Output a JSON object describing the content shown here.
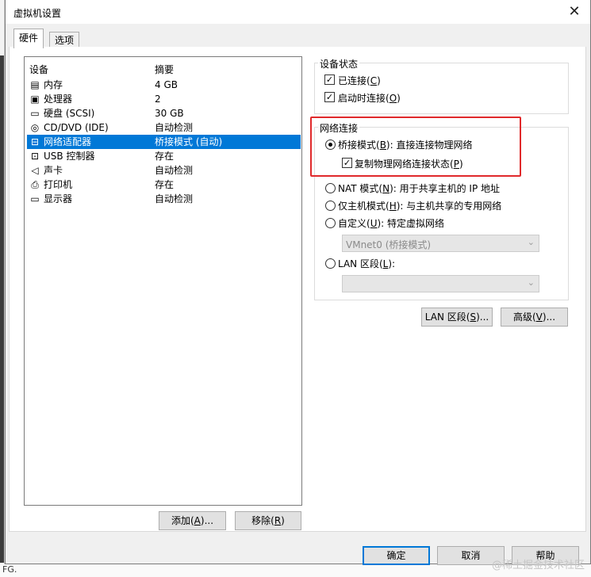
{
  "window": {
    "title": "虚拟机设置"
  },
  "tabs": [
    {
      "label": "硬件"
    },
    {
      "label": "选项"
    }
  ],
  "device_list": {
    "headers": {
      "device": "设备",
      "summary": "摘要"
    },
    "rows": [
      {
        "icon": "memory-icon",
        "name": "内存",
        "summary": "4 GB"
      },
      {
        "icon": "processor-icon",
        "name": "处理器",
        "summary": "2"
      },
      {
        "icon": "hard-disk-icon",
        "name": "硬盘 (SCSI)",
        "summary": "30 GB"
      },
      {
        "icon": "cd-dvd-icon",
        "name": "CD/DVD (IDE)",
        "summary": "自动检测"
      },
      {
        "icon": "network-adapter-icon",
        "name": "网络适配器",
        "summary": "桥接模式 (自动)",
        "selected": true
      },
      {
        "icon": "usb-icon",
        "name": "USB 控制器",
        "summary": "存在"
      },
      {
        "icon": "sound-card-icon",
        "name": "声卡",
        "summary": "自动检测"
      },
      {
        "icon": "printer-icon",
        "name": "打印机",
        "summary": "存在"
      },
      {
        "icon": "display-icon",
        "name": "显示器",
        "summary": "自动检测"
      }
    ]
  },
  "list_buttons": {
    "add": {
      "pre": "添加(",
      "key": "A",
      "post": ")..."
    },
    "remove": {
      "pre": "移除(",
      "key": "R",
      "post": ")"
    }
  },
  "device_status": {
    "title": "设备状态",
    "connected": {
      "pre": "已连接(",
      "key": "C",
      "post": ")",
      "checked": true
    },
    "connect_at_power_on": {
      "pre": "启动时连接(",
      "key": "O",
      "post": ")",
      "checked": true
    }
  },
  "network_connection": {
    "title": "网络连接",
    "bridged": {
      "pre": "桥接模式(",
      "key": "B",
      "post": "): 直接连接物理网络",
      "selected": true
    },
    "replicate": {
      "pre": "复制物理网络连接状态(",
      "key": "P",
      "post": ")",
      "checked": true
    },
    "nat": {
      "pre": "NAT 模式(",
      "key": "N",
      "post": "): 用于共享主机的 IP 地址",
      "selected": false
    },
    "host_only": {
      "pre": "仅主机模式(",
      "key": "H",
      "post": "): 与主机共享的专用网络",
      "selected": false
    },
    "custom": {
      "pre": "自定义(",
      "key": "U",
      "post": "): 特定虚拟网络",
      "selected": false
    },
    "custom_combo_value": "VMnet0 (桥接模式)",
    "lan_segment": {
      "pre": "LAN 区段(",
      "key": "L",
      "post": "):",
      "selected": false
    },
    "lan_combo_value": ""
  },
  "right_buttons": {
    "lan_segments": {
      "pre": "LAN 区段(",
      "key": "S",
      "post": ")..."
    },
    "advanced": {
      "pre": "高级(",
      "key": "V",
      "post": ")..."
    }
  },
  "footer_buttons": {
    "ok": "确定",
    "cancel": "取消",
    "help": "帮助"
  },
  "background": {
    "fragment": "FG."
  },
  "watermark": "@稀土掘金技术社区",
  "colors": {
    "selection": "#0078d7",
    "highlight_box": "#e0292b"
  }
}
